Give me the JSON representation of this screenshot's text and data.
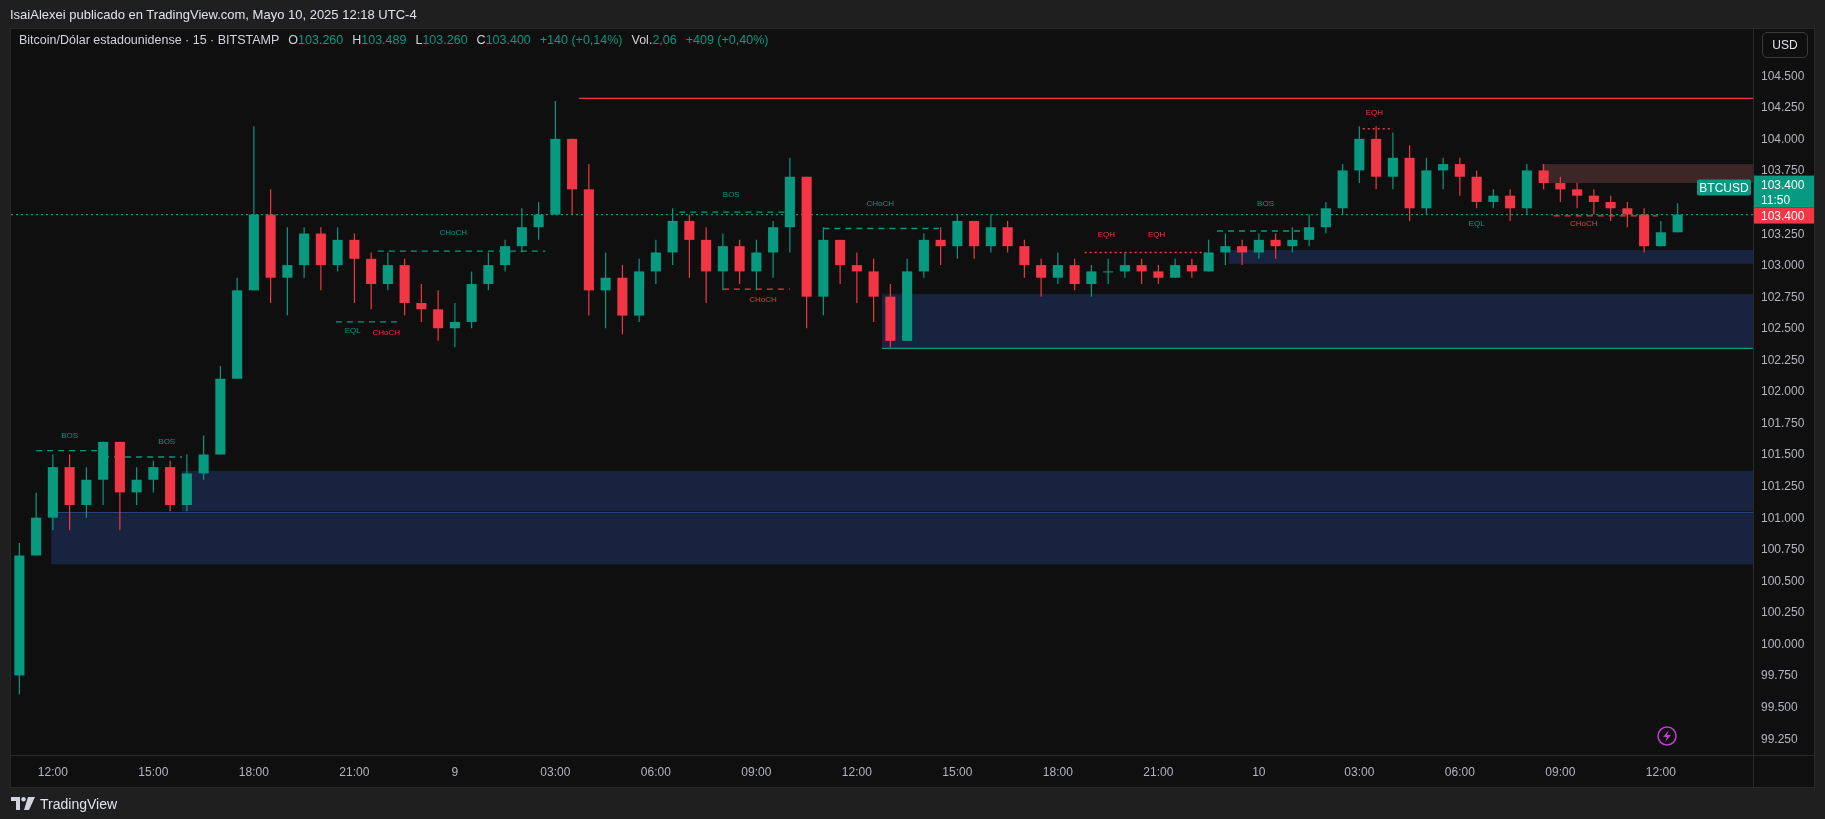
{
  "header": {
    "text": "IsaiAlexei publicado en TradingView.com, Mayo 10, 2025 12:18 UTC-4"
  },
  "legend": {
    "symbol": "Bitcoin/Dólar estadounidense · 15 · BITSTAMP",
    "fields": [
      {
        "label": "O",
        "value": "103.260"
      },
      {
        "label": "H",
        "value": "103.489"
      },
      {
        "label": "L",
        "value": "103.260"
      },
      {
        "label": "C",
        "value": "103.400"
      }
    ],
    "change": "+140 (+0,14%)",
    "volume": {
      "label": "Vol.",
      "value": "2,06",
      "change": "+409 (+0,40%)"
    }
  },
  "currency_button": "USD",
  "price_tags": {
    "symbol": "BTCUSD",
    "last_price": "103.400",
    "countdown": "11:50",
    "close_price": "103.400"
  },
  "chart_data": {
    "type": "candlestick",
    "ylim": [
      99120,
      104870
    ],
    "categories": [
      null,
      null,
      "12:00",
      null,
      null,
      null,
      null,
      null,
      "15:00",
      null,
      null,
      null,
      null,
      null,
      "18:00",
      null,
      null,
      null,
      null,
      null,
      "21:00",
      null,
      null,
      null,
      null,
      null,
      "9",
      null,
      null,
      null,
      null,
      null,
      "03:00",
      null,
      null,
      null,
      null,
      null,
      "06:00",
      null,
      null,
      null,
      null,
      null,
      "09:00",
      null,
      null,
      null,
      null,
      null,
      "12:00",
      null,
      null,
      null,
      null,
      null,
      "15:00",
      null,
      null,
      null,
      null,
      null,
      "18:00",
      null,
      null,
      null,
      null,
      null,
      "21:00",
      null,
      null,
      null,
      null,
      null,
      "10",
      null,
      null,
      null,
      null,
      null,
      "03:00",
      null,
      null,
      null,
      null,
      null,
      "06:00",
      null,
      null,
      null,
      null,
      null,
      "09:00",
      null,
      null,
      null,
      null,
      null,
      "12:00",
      null,
      null,
      null,
      null,
      null
    ],
    "yticks": [
      {
        "value": 104500,
        "label": "104.500"
      },
      {
        "value": 104250,
        "label": "104.250"
      },
      {
        "value": 104000,
        "label": "104.000"
      },
      {
        "value": 103750,
        "label": "103.750"
      },
      {
        "value": 103250,
        "label": "103.250"
      },
      {
        "value": 103000,
        "label": "103.000"
      },
      {
        "value": 102750,
        "label": "102.750"
      },
      {
        "value": 102500,
        "label": "102.500"
      },
      {
        "value": 102250,
        "label": "102.250"
      },
      {
        "value": 102000,
        "label": "102.000"
      },
      {
        "value": 101750,
        "label": "101.750"
      },
      {
        "value": 101500,
        "label": "101.500"
      },
      {
        "value": 101250,
        "label": "101.250"
      },
      {
        "value": 101000,
        "label": "101.000"
      },
      {
        "value": 100750,
        "label": "100.750"
      },
      {
        "value": 100500,
        "label": "100.500"
      },
      {
        "value": 100250,
        "label": "100.250"
      },
      {
        "value": 100000,
        "label": "100.000"
      },
      {
        "value": 99750,
        "label": "99.750"
      },
      {
        "value": 99500,
        "label": "99.500"
      },
      {
        "value": 99250,
        "label": "99.250"
      }
    ],
    "ohlc": [
      [
        99750,
        100800,
        99600,
        100700
      ],
      [
        100700,
        101200,
        100700,
        101000
      ],
      [
        101000,
        101500,
        100900,
        101400
      ],
      [
        101400,
        101500,
        100900,
        101100
      ],
      [
        101100,
        101400,
        101000,
        101300
      ],
      [
        101300,
        101600,
        101100,
        101600
      ],
      [
        101600,
        101600,
        100900,
        101200
      ],
      [
        101200,
        101400,
        101100,
        101300
      ],
      [
        101300,
        101450,
        101200,
        101400
      ],
      [
        101400,
        101450,
        101050,
        101100
      ],
      [
        101100,
        101500,
        101050,
        101350
      ],
      [
        101350,
        101650,
        101300,
        101500
      ],
      [
        101500,
        102200,
        101500,
        102100
      ],
      [
        102100,
        102900,
        102100,
        102800
      ],
      [
        102800,
        104100,
        102800,
        103400
      ],
      [
        103400,
        103600,
        102700,
        102900
      ],
      [
        102900,
        103300,
        102600,
        103000
      ],
      [
        103000,
        103300,
        102900,
        103250
      ],
      [
        103250,
        103300,
        102800,
        103000
      ],
      [
        103000,
        103300,
        102950,
        103200
      ],
      [
        103200,
        103250,
        102700,
        103050
      ],
      [
        103050,
        103100,
        102650,
        102850
      ],
      [
        102850,
        103100,
        102800,
        103000
      ],
      [
        103000,
        103050,
        102600,
        102700
      ],
      [
        102700,
        102850,
        102550,
        102650
      ],
      [
        102650,
        102800,
        102400,
        102500
      ],
      [
        102500,
        102700,
        102350,
        102550
      ],
      [
        102550,
        102950,
        102500,
        102850
      ],
      [
        102850,
        103100,
        102800,
        103000
      ],
      [
        103000,
        103200,
        102950,
        103150
      ],
      [
        103150,
        103450,
        103100,
        103300
      ],
      [
        103300,
        103500,
        103200,
        103400
      ],
      [
        103400,
        104300,
        103400,
        104000
      ],
      [
        104000,
        104000,
        103400,
        103600
      ],
      [
        103600,
        103800,
        102600,
        102800
      ],
      [
        102800,
        103100,
        102500,
        102900
      ],
      [
        102900,
        103000,
        102450,
        102600
      ],
      [
        102600,
        103050,
        102550,
        102950
      ],
      [
        102950,
        103200,
        102850,
        103100
      ],
      [
        103100,
        103450,
        103000,
        103350
      ],
      [
        103350,
        103400,
        102900,
        103200
      ],
      [
        103200,
        103300,
        102700,
        102950
      ],
      [
        102950,
        103250,
        102800,
        103150
      ],
      [
        103150,
        103200,
        102850,
        102950
      ],
      [
        102950,
        103200,
        102800,
        103100
      ],
      [
        103100,
        103350,
        102900,
        103300
      ],
      [
        103300,
        103850,
        103100,
        103700
      ],
      [
        103700,
        103700,
        102500,
        102750
      ],
      [
        102750,
        103300,
        102600,
        103200
      ],
      [
        103200,
        103200,
        102850,
        103000
      ],
      [
        103000,
        103100,
        102700,
        102950
      ],
      [
        102950,
        103050,
        102550,
        102750
      ],
      [
        102750,
        102850,
        102350,
        102400
      ],
      [
        102400,
        103050,
        102400,
        102950
      ],
      [
        102950,
        103250,
        102900,
        103200
      ],
      [
        103200,
        103300,
        103000,
        103150
      ],
      [
        103150,
        103400,
        103050,
        103350
      ],
      [
        103350,
        103350,
        103050,
        103150
      ],
      [
        103150,
        103400,
        103100,
        103300
      ],
      [
        103300,
        103350,
        103100,
        103150
      ],
      [
        103150,
        103200,
        102900,
        103000
      ],
      [
        103000,
        103050,
        102750,
        102900
      ],
      [
        102900,
        103100,
        102850,
        103000
      ],
      [
        103000,
        103050,
        102800,
        102850
      ],
      [
        102850,
        103000,
        102750,
        102950
      ],
      [
        102950,
        103050,
        102850,
        102950
      ],
      [
        102950,
        103100,
        102900,
        103000
      ],
      [
        103000,
        103050,
        102850,
        102950
      ],
      [
        102950,
        103000,
        102850,
        102900
      ],
      [
        102900,
        103050,
        102900,
        103000
      ],
      [
        103000,
        103050,
        102900,
        102950
      ],
      [
        102950,
        103200,
        102950,
        103100
      ],
      [
        103100,
        103250,
        103000,
        103150
      ],
      [
        103150,
        103200,
        103000,
        103100
      ],
      [
        103100,
        103250,
        103050,
        103200
      ],
      [
        103200,
        103250,
        103050,
        103150
      ],
      [
        103150,
        103300,
        103100,
        103200
      ],
      [
        103200,
        103400,
        103150,
        103300
      ],
      [
        103300,
        103500,
        103250,
        103450
      ],
      [
        103450,
        103800,
        103400,
        103750
      ],
      [
        103750,
        104100,
        103650,
        104000
      ],
      [
        104000,
        104100,
        103600,
        103700
      ],
      [
        103700,
        104050,
        103600,
        103850
      ],
      [
        103850,
        103950,
        103350,
        103450
      ],
      [
        103450,
        103850,
        103400,
        103750
      ],
      [
        103750,
        103850,
        103600,
        103800
      ],
      [
        103800,
        103850,
        103550,
        103700
      ],
      [
        103700,
        103750,
        103450,
        103500
      ],
      [
        103500,
        103600,
        103450,
        103550
      ],
      [
        103550,
        103600,
        103350,
        103450
      ],
      [
        103450,
        103800,
        103400,
        103750
      ],
      [
        103750,
        103800,
        103600,
        103650
      ],
      [
        103650,
        103700,
        103500,
        103600
      ],
      [
        103600,
        103650,
        103450,
        103550
      ],
      [
        103550,
        103600,
        103400,
        103500
      ],
      [
        103500,
        103550,
        103350,
        103450
      ],
      [
        103450,
        103500,
        103300,
        103400
      ],
      [
        103400,
        103450,
        103100,
        103150
      ],
      [
        103150,
        103350,
        103150,
        103260
      ],
      [
        103260,
        103489,
        103260,
        103400
      ],
      null,
      null,
      null,
      null
    ],
    "annotations": [
      "BOS",
      "BOS",
      "CHoCH",
      "EQL",
      "CHoCH",
      "BOS",
      "CHoCH",
      "CHoCH",
      "EQH",
      "EQH",
      "BOS",
      "EQH",
      "EQL",
      "CHoCH"
    ]
  },
  "footer": {
    "logo_text": "TradingView"
  }
}
